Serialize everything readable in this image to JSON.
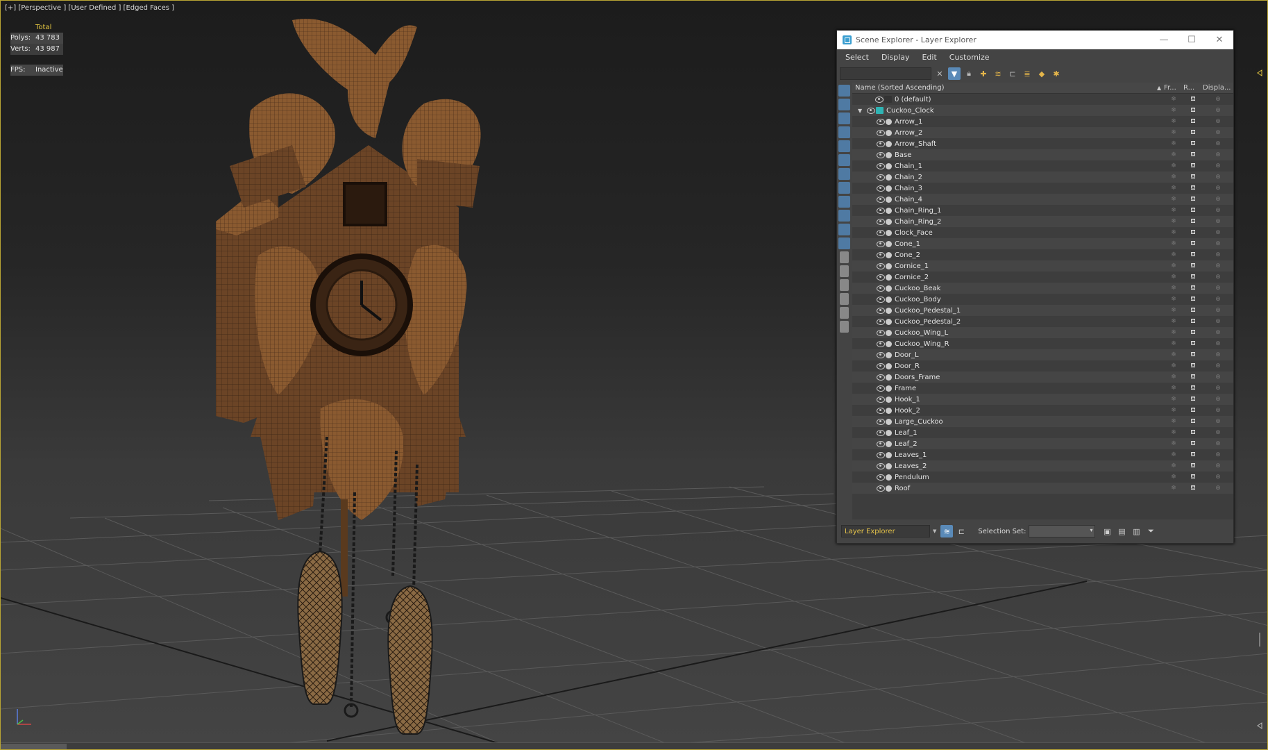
{
  "viewport": {
    "label": "[+] [Perspective ] [User Defined ] [Edged Faces ]",
    "stats": {
      "total_label": "Total",
      "polys_label": "Polys:",
      "polys_value": "43 783",
      "verts_label": "Verts:",
      "verts_value": "43 987",
      "fps_label": "FPS:",
      "fps_value": "Inactive"
    }
  },
  "explorer": {
    "title": "Scene Explorer - Layer Explorer",
    "window_buttons": [
      "—",
      "☐",
      "✕"
    ],
    "menu": [
      "Select",
      "Display",
      "Edit",
      "Customize"
    ],
    "columns": {
      "name": "Name (Sorted Ascending)",
      "sort_arrow": "▲",
      "frozen": "Fr...",
      "render": "R...",
      "display": "Displa..."
    },
    "layers": [
      {
        "name": "0 (default)"
      },
      {
        "name": "Cuckoo_Clock"
      }
    ],
    "objects": [
      "Arrow_1",
      "Arrow_2",
      "Arrow_Shaft",
      "Base",
      "Chain_1",
      "Chain_2",
      "Chain_3",
      "Chain_4",
      "Chain_Ring_1",
      "Chain_Ring_2",
      "Clock_Face",
      "Cone_1",
      "Cone_2",
      "Cornice_1",
      "Cornice_2",
      "Cuckoo_Beak",
      "Cuckoo_Body",
      "Cuckoo_Pedestal_1",
      "Cuckoo_Pedestal_2",
      "Cuckoo_Wing_L",
      "Cuckoo_Wing_R",
      "Door_L",
      "Door_R",
      "Doors_Frame",
      "Frame",
      "Hook_1",
      "Hook_2",
      "Large_Cuckoo",
      "Leaf_1",
      "Leaf_2",
      "Leaves_1",
      "Leaves_2",
      "Pendulum",
      "Roof"
    ],
    "status": {
      "explorer_name": "Layer Explorer",
      "selection_set_label": "Selection Set:"
    }
  },
  "colors": {
    "accent_yellow": "#e4c640",
    "wood": "#6b4426",
    "selection_blue": "#5a8ab8"
  }
}
